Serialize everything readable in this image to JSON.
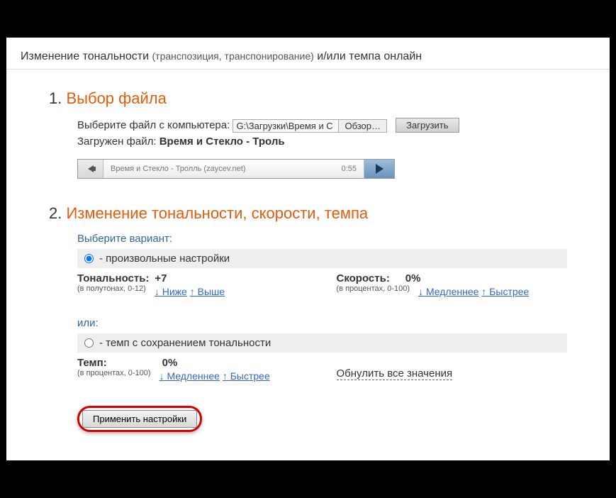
{
  "header": {
    "prefix": "Изменение тональности",
    "paren": "(транспозиция, транспонирование)",
    "suffix": "и/или темпа онлайн"
  },
  "section1": {
    "num": "1.",
    "title": "Выбор файла",
    "choose_label": "Выберите файл с компьютера:",
    "file_path": "G:\\Загрузки\\Время и С",
    "browse_label": "Обзор…",
    "upload_label": "Загрузить",
    "loaded_prefix": "Загружен файл:",
    "loaded_name": "Время и Стекло - Троль",
    "player_track": "Время и Стекло - Тролль (zaycev.net)",
    "player_time": "0:55"
  },
  "section2": {
    "num": "2.",
    "title": "Изменение тональности, скорости, темпа",
    "choose_variant": "Выберите вариант:",
    "radio1_label": "- произвольные настройки",
    "tone": {
      "label": "Тональность:",
      "value": "+7",
      "hint": "(в полутонах, 0-12)",
      "down": "↓ Ниже",
      "up": "↑ Выше"
    },
    "speed": {
      "label": "Скорость:",
      "value": "0%",
      "hint": "(в процентах, 0-100)",
      "down": "↓ Медленнее",
      "up": "↑ Быстрее"
    },
    "or_label": "или:",
    "radio2_label": "- темп с сохранением тональности",
    "tempo": {
      "label": "Темп:",
      "value": "0%",
      "hint": "(в процентах, 0-100)",
      "down": "↓ Медленнее",
      "up": "↑ Быстрее"
    },
    "reset_label": "Обнулить все значения",
    "apply_label": "Применить настройки"
  }
}
